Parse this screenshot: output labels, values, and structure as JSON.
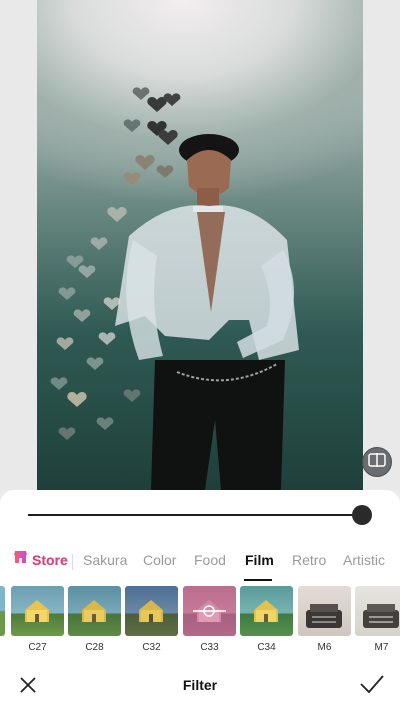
{
  "screen": {
    "title": "Filter"
  },
  "intensity": {
    "value": 1.0
  },
  "tabs": {
    "store_label": "Store",
    "items": [
      {
        "label": "Sakura"
      },
      {
        "label": "Color"
      },
      {
        "label": "Food"
      },
      {
        "label": "Film",
        "active": true
      },
      {
        "label": "Retro"
      },
      {
        "label": "Artistic"
      }
    ]
  },
  "filters": {
    "items": [
      {
        "label": "C27"
      },
      {
        "label": "C28"
      },
      {
        "label": "C32"
      },
      {
        "label": "C33"
      },
      {
        "label": "C34"
      },
      {
        "label": "M6"
      },
      {
        "label": "M7"
      }
    ]
  },
  "colors": {
    "store_gradient_start": "#ff5a6a",
    "store_gradient_end": "#c44be0",
    "active_tab": "#111111",
    "inactive_tab": "#9a9a9a"
  },
  "icons": {
    "compare": "compare-icon",
    "store": "store-icon",
    "close": "close-icon",
    "confirm": "checkmark-icon"
  }
}
